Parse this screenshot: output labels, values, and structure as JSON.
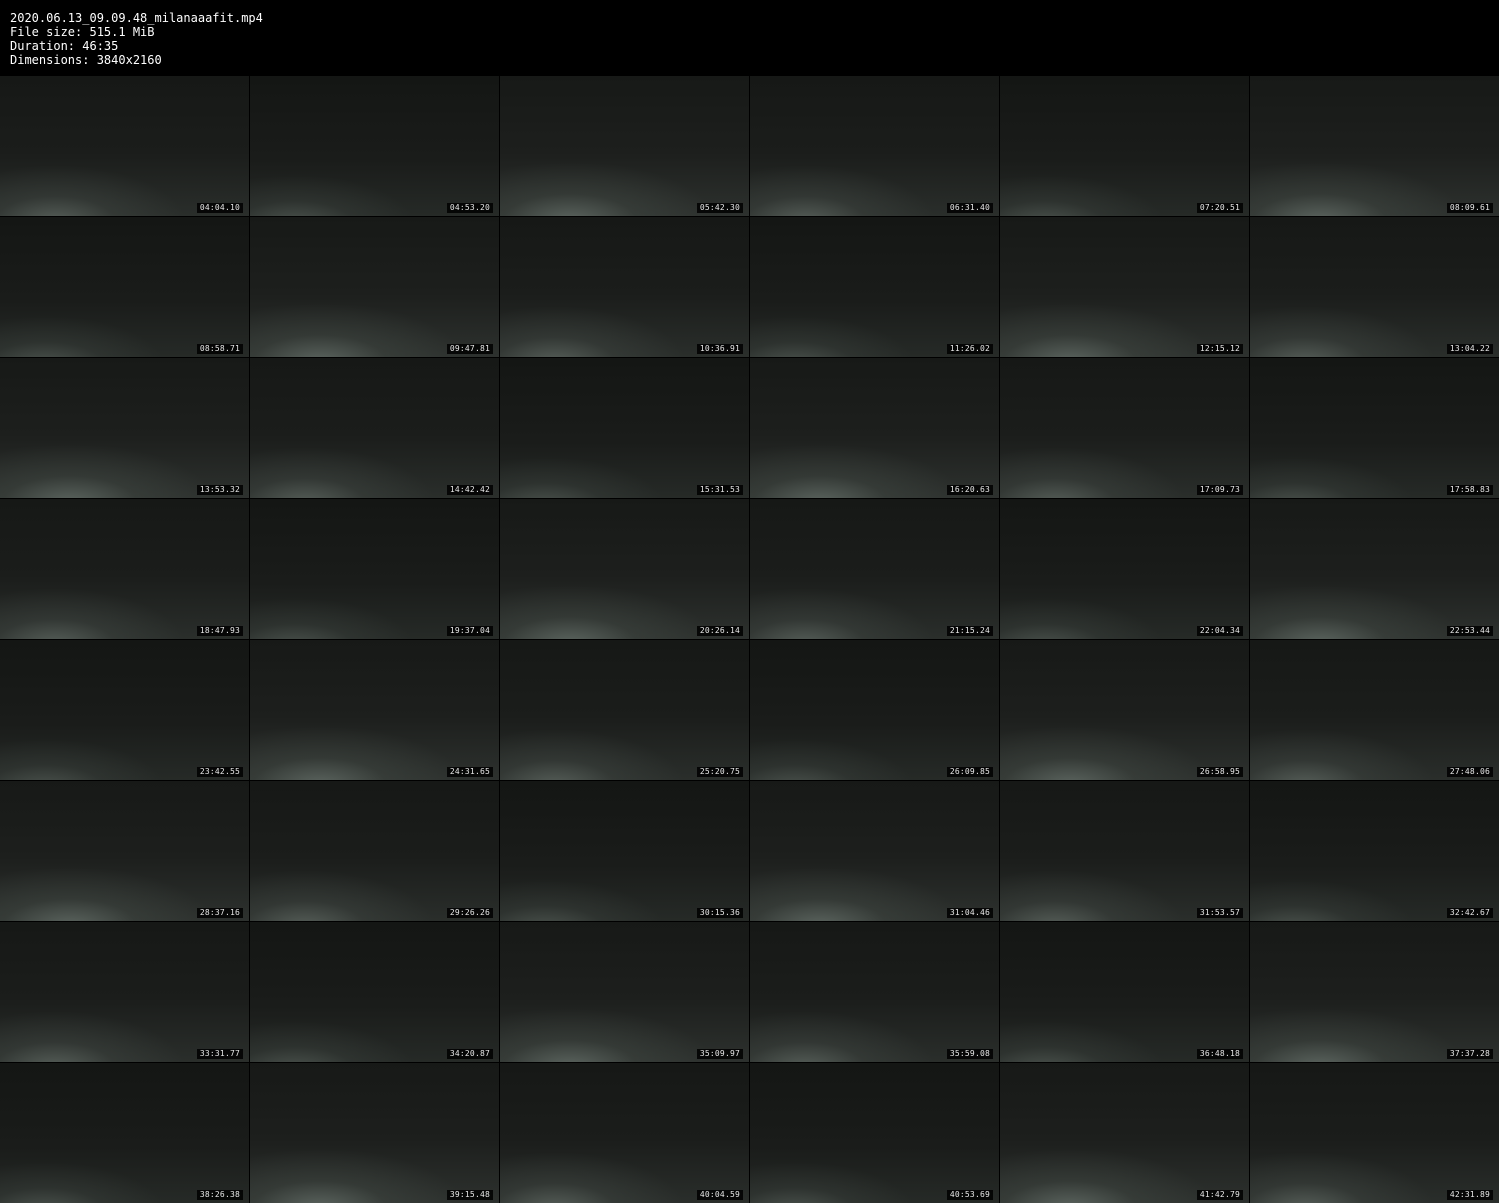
{
  "header": {
    "filename": "2020.06.13_09.09.48_milanaaafit.mp4",
    "file_size": "File size: 515.1 MiB",
    "duration": "Duration: 46:35",
    "dimensions": "Dimensions: 3840x2160"
  },
  "thumbnails": [
    "04:04.10",
    "04:53.20",
    "05:42.30",
    "06:31.40",
    "07:20.51",
    "08:09.61",
    "08:58.71",
    "09:47.81",
    "10:36.91",
    "11:26.02",
    "12:15.12",
    "13:04.22",
    "13:53.32",
    "14:42.42",
    "15:31.53",
    "16:20.63",
    "17:09.73",
    "17:58.83",
    "18:47.93",
    "19:37.04",
    "20:26.14",
    "21:15.24",
    "22:04.34",
    "22:53.44",
    "23:42.55",
    "24:31.65",
    "25:20.75",
    "26:09.85",
    "26:58.95",
    "27:48.06",
    "28:37.16",
    "29:26.26",
    "30:15.36",
    "31:04.46",
    "31:53.57",
    "32:42.67",
    "33:31.77",
    "34:20.87",
    "35:09.97",
    "35:59.08",
    "36:48.18",
    "37:37.28",
    "38:26.38",
    "39:15.48",
    "40:04.59",
    "40:53.69",
    "41:42.79",
    "42:31.89"
  ]
}
